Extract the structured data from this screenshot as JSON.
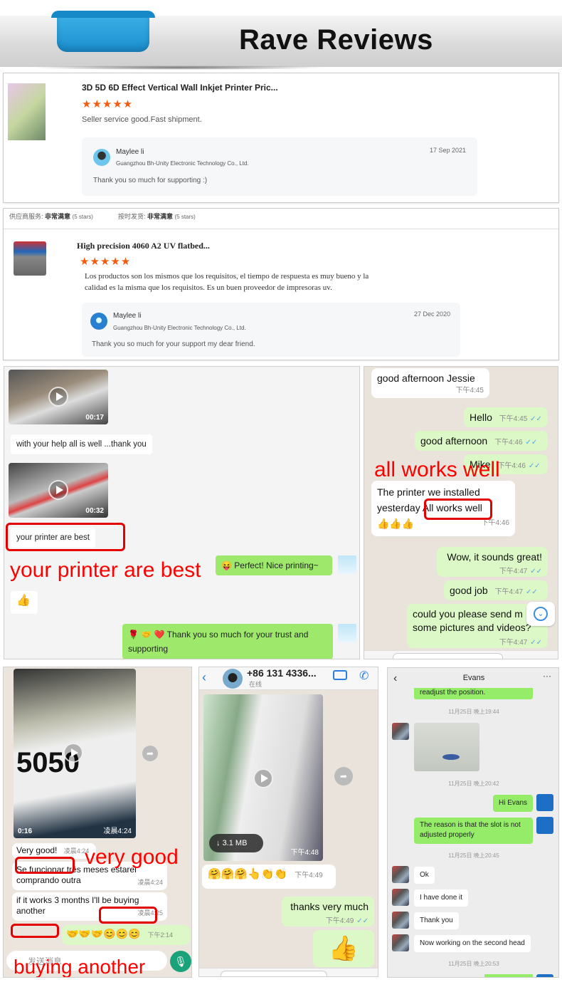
{
  "banner": {
    "title": "Rave Reviews"
  },
  "reviews": [
    {
      "product_title": "3D 5D 6D Effect Vertical Wall Inkjet Printer Pric...",
      "stars": "★★★★★",
      "rating": 5,
      "comment": "Seller service good.Fast shipment.",
      "reply": {
        "name": "Maylee li",
        "company": "Guangzhou Bh-Unity Electronic Technology Co., Ltd.",
        "date": "17 Sep 2021",
        "text": "Thank you so much for supporting :)"
      }
    },
    {
      "ratings_line": [
        {
          "label": "供应商服务:",
          "value": "非常满意",
          "note": "(5 stars)"
        },
        {
          "label": "按时发货:",
          "value": "非常满意",
          "note": "(5 stars)"
        }
      ],
      "product_title": "High precision 4060 A2 UV flatbed...",
      "stars": "★★★★★",
      "rating": 5,
      "comment_line1": "Los productos son los mismos que los requisitos, el tiempo de respuesta es muy bueno y la",
      "comment_line2": "calidad es la misma que los requisitos. Es un buen proveedor de impresoras uv.",
      "reply": {
        "name": "Maylee li",
        "company": "Guangzhou Bh-Unity Electronic Technology Co., Ltd.",
        "date": "27 Dec 2020",
        "text": "Thank you so much for your support my dear friend."
      }
    }
  ],
  "chat1": {
    "video1_duration": "00:17",
    "msg1": "with your help all is well ...thank you",
    "video2_duration": "00:32",
    "msg2": "your printer are best",
    "annotation": "your printer are best",
    "reply1_emoji": "😝",
    "reply1": "Perfect! Nice printing~",
    "thumb": "👍",
    "reply2_emoji": "🌹 🤝 ❤️",
    "reply2": "Thank you so much for your trust and supporting"
  },
  "chat2": {
    "messages": [
      {
        "text": "good afternoon Jessie",
        "time": "下午4:45",
        "side": "in"
      },
      {
        "text": "Hello",
        "time": "下午4:45",
        "side": "out"
      },
      {
        "text": "good afternoon",
        "time": "下午4:46",
        "side": "out"
      },
      {
        "text": "Mike",
        "time": "下午4:46",
        "side": "out"
      },
      {
        "text_a": "The printer we installed",
        "text_b": "yesterday",
        "highlight": "All works well",
        "emoji": "👍👍👍",
        "time": "下午4:46",
        "side": "in"
      },
      {
        "text": "Wow, it sounds great!",
        "time": "下午4:47",
        "side": "out"
      },
      {
        "text": "good job",
        "time": "下午4:47",
        "side": "out"
      },
      {
        "text_a": "could you please send m",
        "text_b": "some pictures and videos?",
        "time": "下午4:47",
        "side": "out"
      }
    ],
    "annotation": "all works well",
    "tick": "✓✓"
  },
  "chat3": {
    "video_duration": "0:16",
    "video_time": "凌晨4:24",
    "msg1": "Very good!",
    "msg1_time": "凌晨4:24",
    "msg2": "Se funcionar três meses estarei comprando outra",
    "msg2_time": "凌晨4:24",
    "msg3": "if it works 3 months I'll be buying another",
    "msg3_time": "凌晨4:25",
    "reply_emoji": "🤝🤝🤝😊😊😊",
    "reply_time": "下午2:14",
    "input_placeholder": "发送消息",
    "annotation1": "very good",
    "annotation2": "buying another"
  },
  "chat4": {
    "contact": "+86 131 4336...",
    "status": "在线",
    "video_size": "3.1 MB",
    "video_time": "下午4:48",
    "emoji_msg": "🤗🤗🤗👆👏👏",
    "emoji_time": "下午4:49",
    "msg": "thanks very much",
    "msg_time": "下午4:49",
    "thumb": "👍"
  },
  "chat5": {
    "contact": "Evans",
    "msg_top": "readjust the position.",
    "ts1": "11月25日 晚上19:44",
    "ts2": "11月25日 晚上20:42",
    "msg_hi": "Hi Evans",
    "msg_reason": "The reason is that the slot is not adjusted properly",
    "ts3": "11月25日 晚上20:45",
    "in1": "Ok",
    "in2": "I have done it",
    "in3": "Thank you",
    "in4": "Now working on the second head",
    "ts4": "11月25日 晚上20:53"
  }
}
